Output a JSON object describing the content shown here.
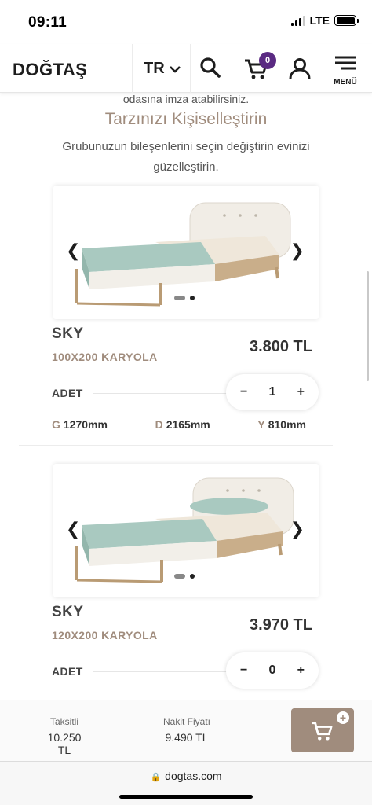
{
  "status_bar": {
    "time": "09:11",
    "network": "LTE"
  },
  "header": {
    "logo": "DOĞTAŞ",
    "language": "TR",
    "cart_count": "0",
    "menu_label": "MENÜ"
  },
  "content": {
    "partial_text": "odasına imza atabilirsiniz.",
    "section_title": "Tarzınızı Kişiselleştirin",
    "section_description": "Grubunuzun bileşenlerini seçin değiştirin evinizi güzelleştirin."
  },
  "products": [
    {
      "name": "SKY",
      "subtitle": "100X200 KARYOLA",
      "price": "3.800 TL",
      "quantity_label": "ADET",
      "quantity": "1",
      "dims": [
        {
          "key": "G",
          "value": "1270mm"
        },
        {
          "key": "D",
          "value": "2165mm"
        },
        {
          "key": "Y",
          "value": "810mm"
        }
      ]
    },
    {
      "name": "SKY",
      "subtitle": "120X200 KARYOLA",
      "price": "3.970 TL",
      "quantity_label": "ADET",
      "quantity": "0"
    }
  ],
  "bottom_bar": {
    "installment_label": "Taksitli",
    "installment_price": "10.250 TL",
    "cash_label": "Nakit Fiyatı",
    "cash_price": "9.490 TL"
  },
  "browser": {
    "url": "dogtas.com"
  },
  "colors": {
    "brand_taupe": "#a08c7d",
    "badge_purple": "#5a2a82",
    "text_dark": "#1d1d1d"
  }
}
